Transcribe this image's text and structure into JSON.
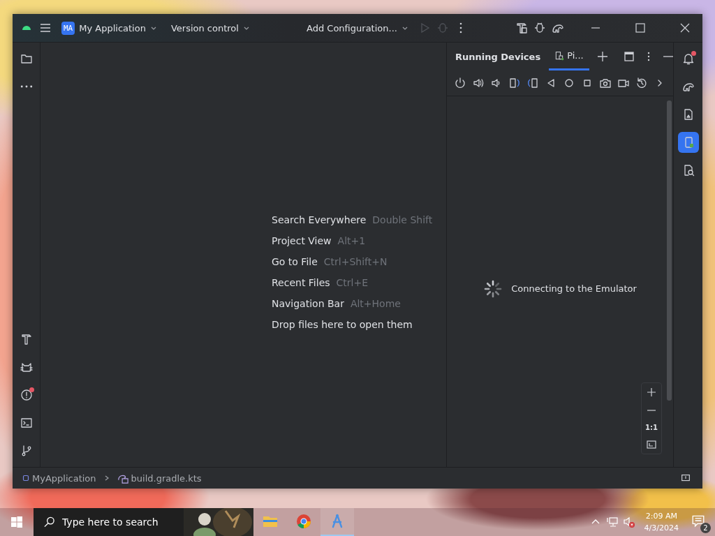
{
  "title_bar": {
    "project_badge": "MA",
    "project": "My Application",
    "vcs": "Version control",
    "run_config": "Add Configuration..."
  },
  "left_strip": [
    {
      "kind": "project",
      "selected": false
    },
    {
      "kind": "more",
      "selected": false
    }
  ],
  "left_strip_bottom": [
    {
      "kind": "build",
      "selected": false
    },
    {
      "kind": "logcat",
      "selected": false
    },
    {
      "kind": "problems",
      "selected": false,
      "alert": true
    },
    {
      "kind": "terminal",
      "selected": false
    },
    {
      "kind": "git",
      "selected": false
    }
  ],
  "editor_hints": [
    {
      "action": "Search Everywhere",
      "shortcut": "Double Shift"
    },
    {
      "action": "Project View",
      "shortcut": "Alt+1"
    },
    {
      "action": "Go to File",
      "shortcut": "Ctrl+Shift+N"
    },
    {
      "action": "Recent Files",
      "shortcut": "Ctrl+E"
    },
    {
      "action": "Navigation Bar",
      "shortcut": "Alt+Home"
    },
    {
      "action": "Drop files here to open them"
    }
  ],
  "running_devices": {
    "title": "Running Devices",
    "tabs": [
      {
        "label": "Pi...",
        "selected": true
      }
    ],
    "status": "Connecting to the Emulator",
    "zoom_actual": "1:1"
  },
  "right_strip": [
    {
      "kind": "notifications",
      "selected": false,
      "alert": true
    },
    {
      "kind": "gradle",
      "selected": false
    },
    {
      "kind": "device_files",
      "selected": false
    },
    {
      "kind": "running_devices",
      "selected": true
    },
    {
      "kind": "app_inspection",
      "selected": false
    }
  ],
  "breadcrumbs": [
    "MyApplication",
    "build.gradle.kts"
  ],
  "taskbar": {
    "search_placeholder": "Type here to search",
    "apps": [
      {
        "kind": "files",
        "selected": false
      },
      {
        "kind": "chrome",
        "selected": false
      },
      {
        "kind": "studio",
        "selected": true
      }
    ],
    "time": "2:09 AM",
    "date": "4/3/2024",
    "notification_count": "2"
  }
}
